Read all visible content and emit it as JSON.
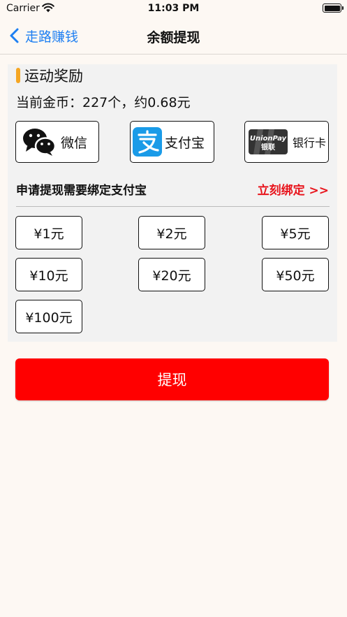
{
  "status_bar": {
    "carrier": "Carrier",
    "time": "11:03 PM"
  },
  "nav": {
    "back_label": "走路赚钱",
    "title": "余额提现"
  },
  "reward": {
    "section_title": "运动奖励",
    "coin_info": "当前金币：227个，约0.68元"
  },
  "payment_methods": [
    {
      "label": "微信",
      "icon": "wechat-icon"
    },
    {
      "label": "支付宝",
      "icon": "alipay-icon"
    },
    {
      "label": "银行卡",
      "icon": "unionpay-icon",
      "logo_text_top": "UnionPay",
      "logo_text_bottom": "银联"
    }
  ],
  "binding": {
    "prompt": "申请提现需要绑定支付宝",
    "link": "立刻绑定 >>"
  },
  "amounts": [
    "¥1元",
    "¥2元",
    "¥5元",
    "¥10元",
    "¥20元",
    "¥50元",
    "¥100元"
  ],
  "withdraw_button": "提现",
  "colors": {
    "accent_blue": "#1e7ff2",
    "withdraw_red": "#ff0000",
    "link_red": "#e8141c",
    "section_bar_orange": "#f5a623",
    "alipay_blue": "#1a9be8"
  }
}
